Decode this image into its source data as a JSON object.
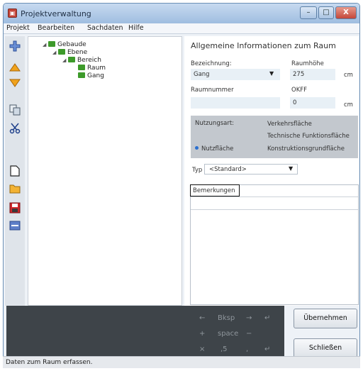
{
  "window": {
    "title": "Projektverwaltung",
    "controls": {
      "minimize": "–",
      "maximize": "□",
      "close": "X"
    }
  },
  "menu": [
    "Projekt",
    "Bearbeiten",
    "Sachdaten",
    "Hilfe"
  ],
  "toolbar_icons": [
    "plus-icon",
    "arrow-up-icon",
    "arrow-down-icon",
    "copy-icon",
    "scissors-icon",
    "new-document-icon",
    "open-folder-icon",
    "save-icon",
    "minus-icon"
  ],
  "tree": [
    {
      "label": "Gebaude",
      "level": 0
    },
    {
      "label": "Ebene",
      "level": 1
    },
    {
      "label": "Bereich",
      "level": 2
    },
    {
      "label": "Raum",
      "level": 3
    },
    {
      "label": "Gang",
      "level": 3
    }
  ],
  "form": {
    "heading": "Allgemeine Informationen zum Raum",
    "bezeichnung_label": "Bezeichnung:",
    "bezeichnung_value": "Gang",
    "raumhoehe_label": "Raumhöhe",
    "raumhoehe_value": "275",
    "raumhoehe_unit": "cm",
    "raumnummer_label": "Raumnummer",
    "okff_label": "OKFF",
    "okff_value": "0",
    "okff_unit": "cm",
    "nutzungsart_label": "Nutzungsart:",
    "radio_options": [
      "Verkehrsfläche",
      "Technische Funktionsfläche",
      "Nutzfläche",
      "Konstruktionsgrundfläche"
    ],
    "radio_selected": "Nutzfläche",
    "typ_label": "Typ",
    "typ_value": "<Standard>",
    "memo_tab": "Bemerkungen"
  },
  "numpad": {
    "row1": [
      "←",
      "Bksp",
      "→",
      "↵"
    ],
    "row2": [
      "+",
      "space",
      "−"
    ],
    "row3": [
      "×",
      ",5",
      ",",
      "↵"
    ]
  },
  "buttons": {
    "apply": "Übernehmen",
    "close": "Schließen"
  },
  "status": "Daten zum Raum erfassen."
}
